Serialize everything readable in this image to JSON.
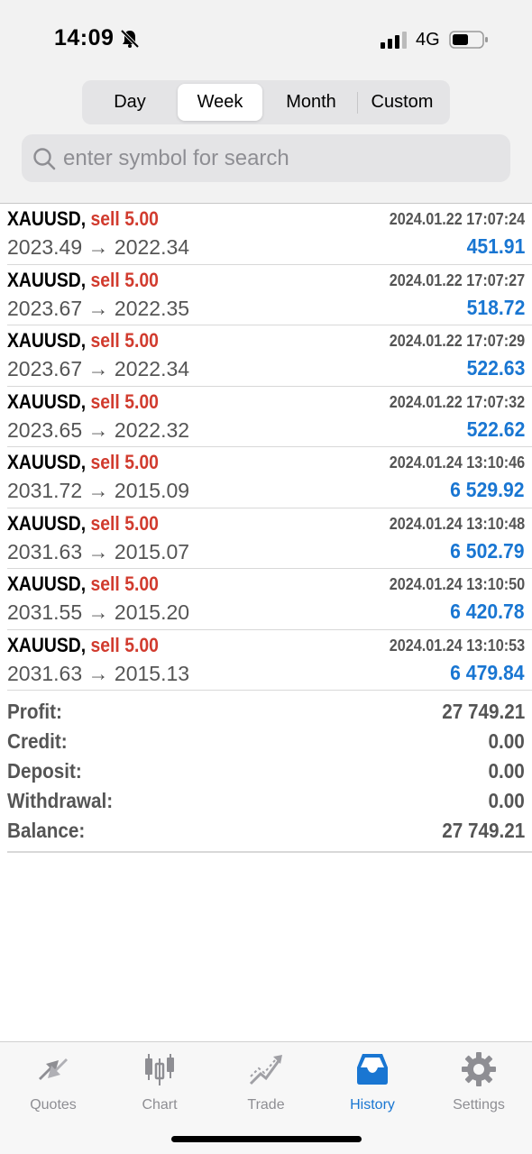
{
  "status_bar": {
    "time": "14:09",
    "network": "4G"
  },
  "period_tabs": [
    {
      "label": "Day",
      "active": false
    },
    {
      "label": "Week",
      "active": true
    },
    {
      "label": "Month",
      "active": false
    },
    {
      "label": "Custom",
      "active": false
    }
  ],
  "search": {
    "placeholder": "enter symbol for search"
  },
  "deals": [
    {
      "symbol": "XAUUSD,",
      "type": "sell 5.00",
      "time": "2024.01.22 17:07:24",
      "prices": "2023.49 → 2022.34",
      "profit": "451.91"
    },
    {
      "symbol": "XAUUSD,",
      "type": "sell 5.00",
      "time": "2024.01.22 17:07:27",
      "prices": "2023.67 → 2022.35",
      "profit": "518.72"
    },
    {
      "symbol": "XAUUSD,",
      "type": "sell 5.00",
      "time": "2024.01.22 17:07:29",
      "prices": "2023.67 → 2022.34",
      "profit": "522.63"
    },
    {
      "symbol": "XAUUSD,",
      "type": "sell 5.00",
      "time": "2024.01.22 17:07:32",
      "prices": "2023.65 → 2022.32",
      "profit": "522.62"
    },
    {
      "symbol": "XAUUSD,",
      "type": "sell 5.00",
      "time": "2024.01.24 13:10:46",
      "prices": "2031.72 → 2015.09",
      "profit": "6 529.92"
    },
    {
      "symbol": "XAUUSD,",
      "type": "sell 5.00",
      "time": "2024.01.24 13:10:48",
      "prices": "2031.63 → 2015.07",
      "profit": "6 502.79"
    },
    {
      "symbol": "XAUUSD,",
      "type": "sell 5.00",
      "time": "2024.01.24 13:10:50",
      "prices": "2031.55 → 2015.20",
      "profit": "6 420.78"
    },
    {
      "symbol": "XAUUSD,",
      "type": "sell 5.00",
      "time": "2024.01.24 13:10:53",
      "prices": "2031.63 → 2015.13",
      "profit": "6 479.84"
    }
  ],
  "summary": [
    {
      "label": "Profit:",
      "value": "27 749.21"
    },
    {
      "label": "Credit:",
      "value": "0.00"
    },
    {
      "label": "Deposit:",
      "value": "0.00"
    },
    {
      "label": "Withdrawal:",
      "value": "0.00"
    },
    {
      "label": "Balance:",
      "value": "27 749.21"
    }
  ],
  "tab_bar": [
    {
      "label": "Quotes",
      "icon": "quotes-icon",
      "active": false
    },
    {
      "label": "Chart",
      "icon": "chart-icon",
      "active": false
    },
    {
      "label": "Trade",
      "icon": "trade-icon",
      "active": false
    },
    {
      "label": "History",
      "icon": "history-icon",
      "active": true
    },
    {
      "label": "Settings",
      "icon": "settings-icon",
      "active": false
    }
  ],
  "colors": {
    "accent": "#1976d2",
    "sell": "#d13b2e",
    "inactive": "#8e8e93"
  }
}
